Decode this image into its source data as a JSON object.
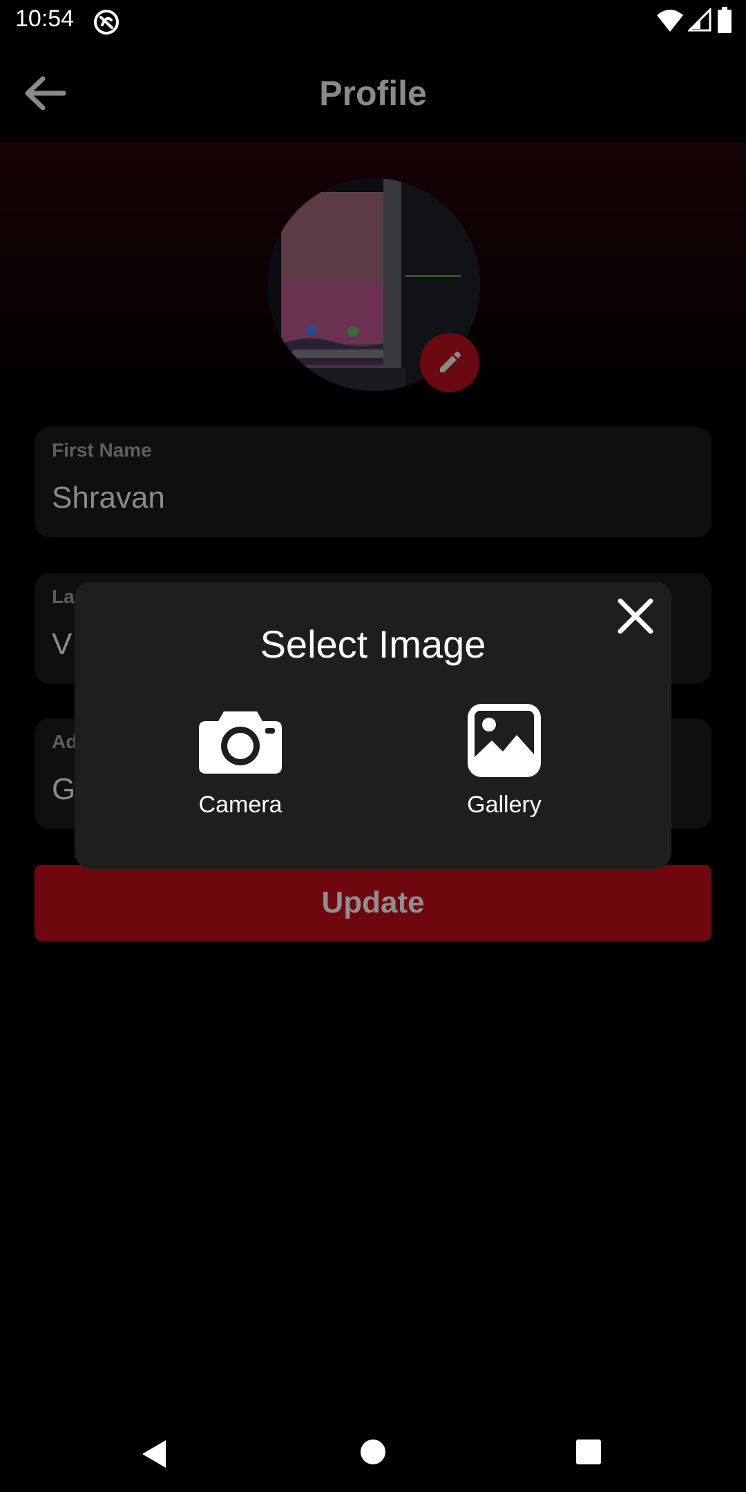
{
  "status_bar": {
    "time": "10:54"
  },
  "app_bar": {
    "title": "Profile"
  },
  "form": {
    "first_name": {
      "label": "First Name",
      "value": "Shravan"
    },
    "last_name": {
      "label": "La",
      "value": "V"
    },
    "address": {
      "label": "Ad",
      "value": "G"
    },
    "update_label": "Update"
  },
  "dialog": {
    "title": "Select Image",
    "options": [
      {
        "label": "Camera",
        "icon": "camera-icon"
      },
      {
        "label": "Gallery",
        "icon": "gallery-icon"
      }
    ]
  },
  "colors": {
    "accent": "#6e080e",
    "dialog_bg": "#1e1e1e",
    "field_bg": "#0f0f0f"
  }
}
